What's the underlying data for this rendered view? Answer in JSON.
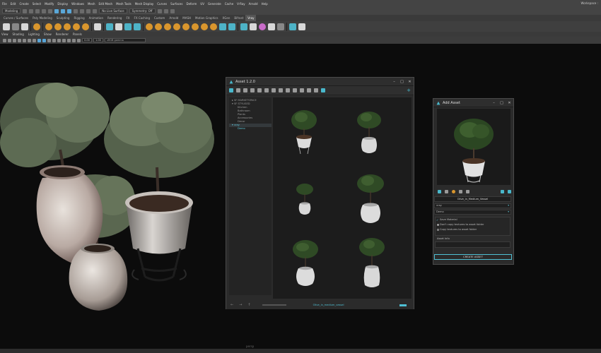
{
  "menubar": {
    "items": [
      "File",
      "Edit",
      "Create",
      "Select",
      "Modify",
      "Display",
      "Windows",
      "Mesh",
      "Edit Mesh",
      "Mesh Tools",
      "Mesh Display",
      "Curves",
      "Surfaces",
      "Deform",
      "UV",
      "Generate",
      "Cache",
      "V-Ray",
      "Arnold",
      "Help"
    ],
    "workspace": "Workspace :"
  },
  "statusline": {
    "mode": "Modeling",
    "live_surface": "No Live Surface",
    "symmetry": "Symmetry: Off"
  },
  "shelf": {
    "tabs": [
      "Curves / Surfaces",
      "Poly Modeling",
      "Sculpting",
      "Rigging",
      "Animation",
      "Rendering",
      "FX",
      "FX Caching",
      "Custom",
      "Arnold",
      "MASH",
      "Motion Graphics",
      "XGen",
      "Bifrost",
      "Vray"
    ],
    "active_tab": "Vray"
  },
  "panel_menu": [
    "View",
    "Shading",
    "Lighting",
    "Show",
    "Renderer",
    "Panels"
  ],
  "panel_tools": {
    "near": "0.00",
    "far": "1.00",
    "camera": "sRGB gamma"
  },
  "viewport": {
    "label": "persp"
  },
  "asset_window": {
    "title": "Asset 1.2.0",
    "tree": [
      {
        "label": "▸ SF MARKETSPACE",
        "level": 0
      },
      {
        "label": "▾ SF STYLISED",
        "level": 0
      },
      {
        "label": "Kitchen",
        "level": 1
      },
      {
        "label": "Bathroom",
        "level": 1
      },
      {
        "label": "Plants",
        "level": 1
      },
      {
        "label": "Accessories",
        "level": 1
      },
      {
        "label": "Decor",
        "level": 1
      },
      {
        "label": "▾ vray",
        "level": 0
      },
      {
        "label": "Demo",
        "level": 1
      }
    ],
    "selected_file": "Olive_in_medium_vessel"
  },
  "add_asset": {
    "title": "Add Asset",
    "asset_name": "Olive_in_Medium_Vessel",
    "library": "vray",
    "category": "Demo",
    "options": [
      "Save Material",
      "Don't copy textures to asset folder",
      "Copy textures to asset folder"
    ],
    "asset_info_label": "Asset Info",
    "create_button": "CREATE ASSET"
  }
}
